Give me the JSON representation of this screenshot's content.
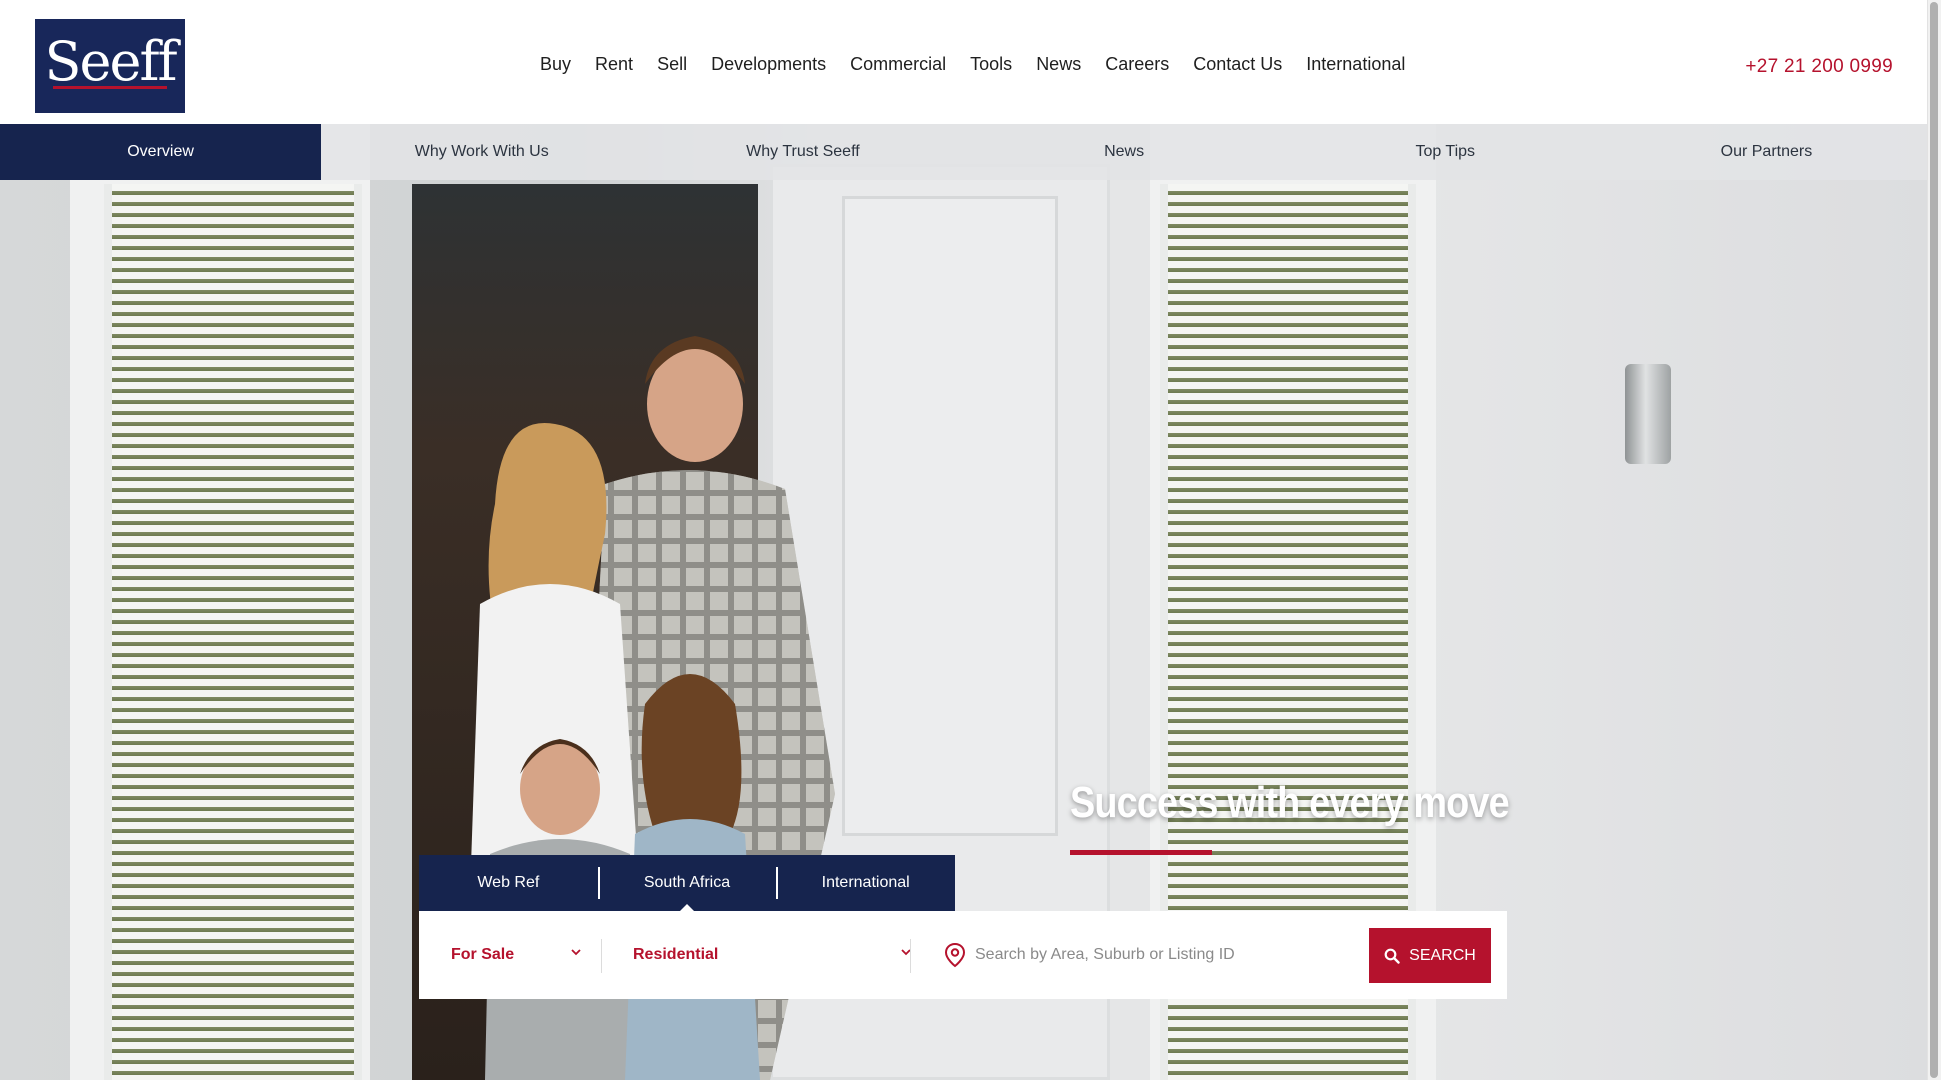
{
  "brand": {
    "logo_text": "Seeff"
  },
  "header": {
    "nav": [
      "Buy",
      "Rent",
      "Sell",
      "Developments",
      "Commercial",
      "Tools",
      "News",
      "Careers",
      "Contact Us",
      "International"
    ],
    "phone": "+27 21 200 0999"
  },
  "subnav": {
    "tabs": [
      "Overview",
      "Why Work With Us",
      "Why Trust Seeff",
      "News",
      "Top Tips",
      "Our Partners"
    ],
    "active": "Overview"
  },
  "hero": {
    "tagline": "Success with every move"
  },
  "search": {
    "tabs": [
      "Web Ref",
      "South Africa",
      "International"
    ],
    "active_tab": "South Africa",
    "listing_type": "For Sale",
    "property_type": "Residential",
    "placeholder": "Search by Area, Suburb or Listing ID",
    "button_label": "SEARCH"
  },
  "colors": {
    "brand_navy": "#16244e",
    "brand_red": "#b5122d"
  },
  "icons": {
    "pin": "map-pin-icon",
    "search": "search-icon",
    "chevron": "chevron-down-icon"
  }
}
